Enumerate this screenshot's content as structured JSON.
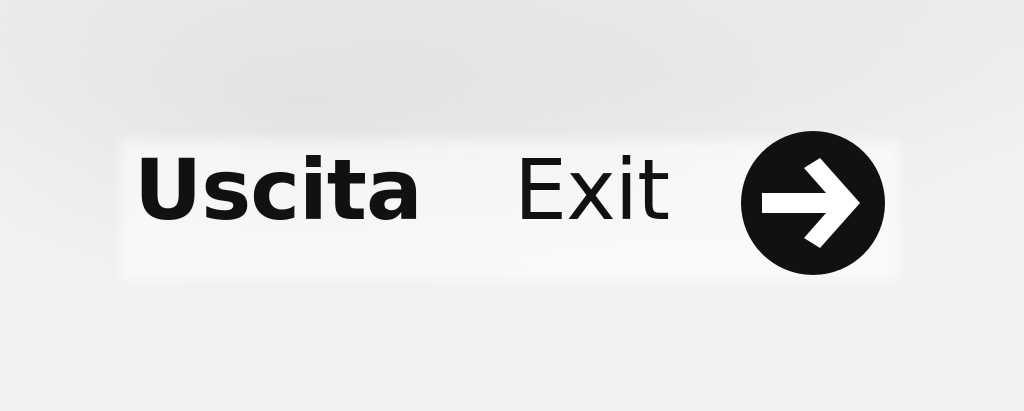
{
  "sign": {
    "label_italian": "Uscita",
    "label_english": "Exit",
    "arrow_icon": "arrow-right-icon",
    "colors": {
      "background": "#efefef",
      "text": "#111111",
      "disc": "#111111",
      "arrow": "#ffffff"
    }
  }
}
